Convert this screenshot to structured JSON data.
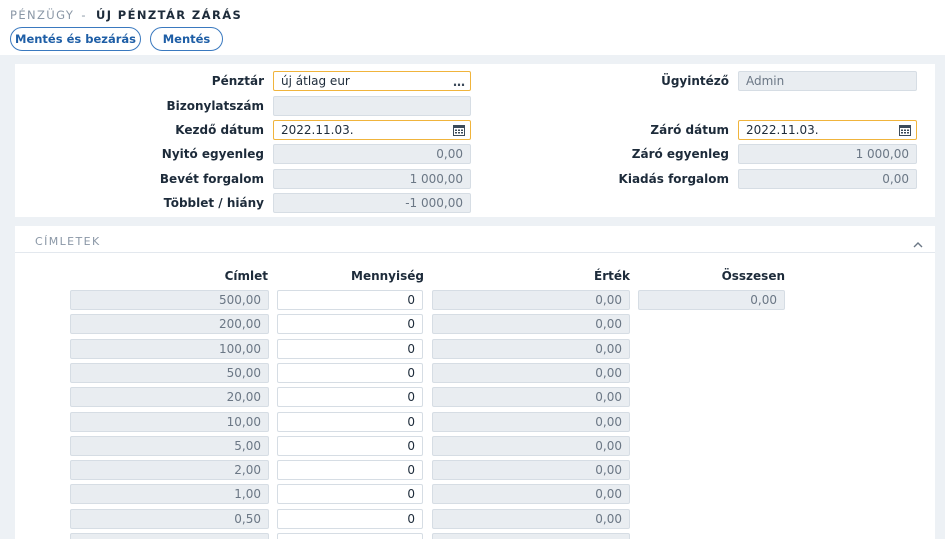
{
  "header": {
    "breadcrumb_parent": "PÉNZÜGY",
    "separator": "-",
    "title": "ÚJ PÉNZTÁR ZÁRÁS"
  },
  "toolbar": {
    "save_close_label": "Mentés és bezárás",
    "save_label": "Mentés"
  },
  "form": {
    "penztar": {
      "label": "Pénztár",
      "value": "új átlag eur"
    },
    "bizonylatszam": {
      "label": "Bizonylatszám",
      "value": ""
    },
    "kezdo_datum": {
      "label": "Kezdő dátum",
      "value": "2022.11.03."
    },
    "nyito_egyenleg": {
      "label": "Nyitó egyenleg",
      "value": "0,00"
    },
    "bevet_forgalom": {
      "label": "Bevét forgalom",
      "value": "1 000,00"
    },
    "tobblet_hiany": {
      "label": "Többlet / hiány",
      "value": "-1 000,00"
    },
    "ugyintezo": {
      "label": "Ügyintéző",
      "value": "Admin"
    },
    "zaro_datum": {
      "label": "Záró dátum",
      "value": "2022.11.03."
    },
    "zaro_egyenleg": {
      "label": "Záró egyenleg",
      "value": "1 000,00"
    },
    "kiadas_forgalom": {
      "label": "Kiadás forgalom",
      "value": "0,00"
    }
  },
  "denominations": {
    "section_title": "CÍMLETEK",
    "headers": {
      "cimlet": "Címlet",
      "mennyiseg": "Mennyiség",
      "ertek": "Érték",
      "osszesen": "Összesen"
    },
    "total": "0,00",
    "rows": [
      {
        "cimlet": "500,00",
        "mennyiseg": "0",
        "ertek": "0,00"
      },
      {
        "cimlet": "200,00",
        "mennyiseg": "0",
        "ertek": "0,00"
      },
      {
        "cimlet": "100,00",
        "mennyiseg": "0",
        "ertek": "0,00"
      },
      {
        "cimlet": "50,00",
        "mennyiseg": "0",
        "ertek": "0,00"
      },
      {
        "cimlet": "20,00",
        "mennyiseg": "0",
        "ertek": "0,00"
      },
      {
        "cimlet": "10,00",
        "mennyiseg": "0",
        "ertek": "0,00"
      },
      {
        "cimlet": "5,00",
        "mennyiseg": "0",
        "ertek": "0,00"
      },
      {
        "cimlet": "2,00",
        "mennyiseg": "0",
        "ertek": "0,00"
      },
      {
        "cimlet": "1,00",
        "mennyiseg": "0",
        "ertek": "0,00"
      },
      {
        "cimlet": "0,50",
        "mennyiseg": "0",
        "ertek": "0,00"
      },
      {
        "cimlet": "",
        "mennyiseg": "",
        "ertek": ""
      }
    ]
  },
  "icons": {
    "calendar": "calendar-icon",
    "ellipsis": "ellipsis-icon",
    "collapse": "chevron-up-icon"
  },
  "colors": {
    "accent": "#3a79bf",
    "focus_border": "#f0b43c",
    "readonly_bg": "#e9edf1",
    "page_bg": "#edf1f5"
  }
}
